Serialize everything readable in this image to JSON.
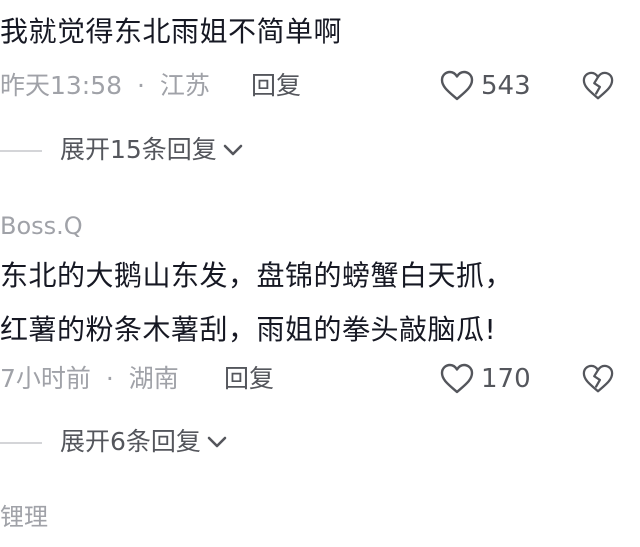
{
  "comments": [
    {
      "text": "我就觉得东北雨姐不简单啊",
      "time": "昨天13:58",
      "separator": "·",
      "location": "江苏",
      "reply_label": "回复",
      "likes": "543",
      "expand_label": "展开15条回复"
    },
    {
      "username": "Boss.Q",
      "text_lines": [
        "东北的大鹅山东发，盘锦的螃蟹白天抓，",
        "红薯的粉条木薯刮，雨姐的拳头敲脑瓜!"
      ],
      "time": "7小时前",
      "separator": "·",
      "location": "湖南",
      "reply_label": "回复",
      "likes": "170",
      "expand_label": "展开6条回复"
    },
    {
      "username": "锂理"
    }
  ],
  "icons": {
    "like": "heart-outline-icon",
    "dislike": "broken-heart-icon",
    "expand": "chevron-down-icon"
  },
  "colors": {
    "primary_text": "#161823",
    "meta_text": "#a0a2a8",
    "action_text": "#54565c",
    "divider": "#d4d5d8"
  }
}
